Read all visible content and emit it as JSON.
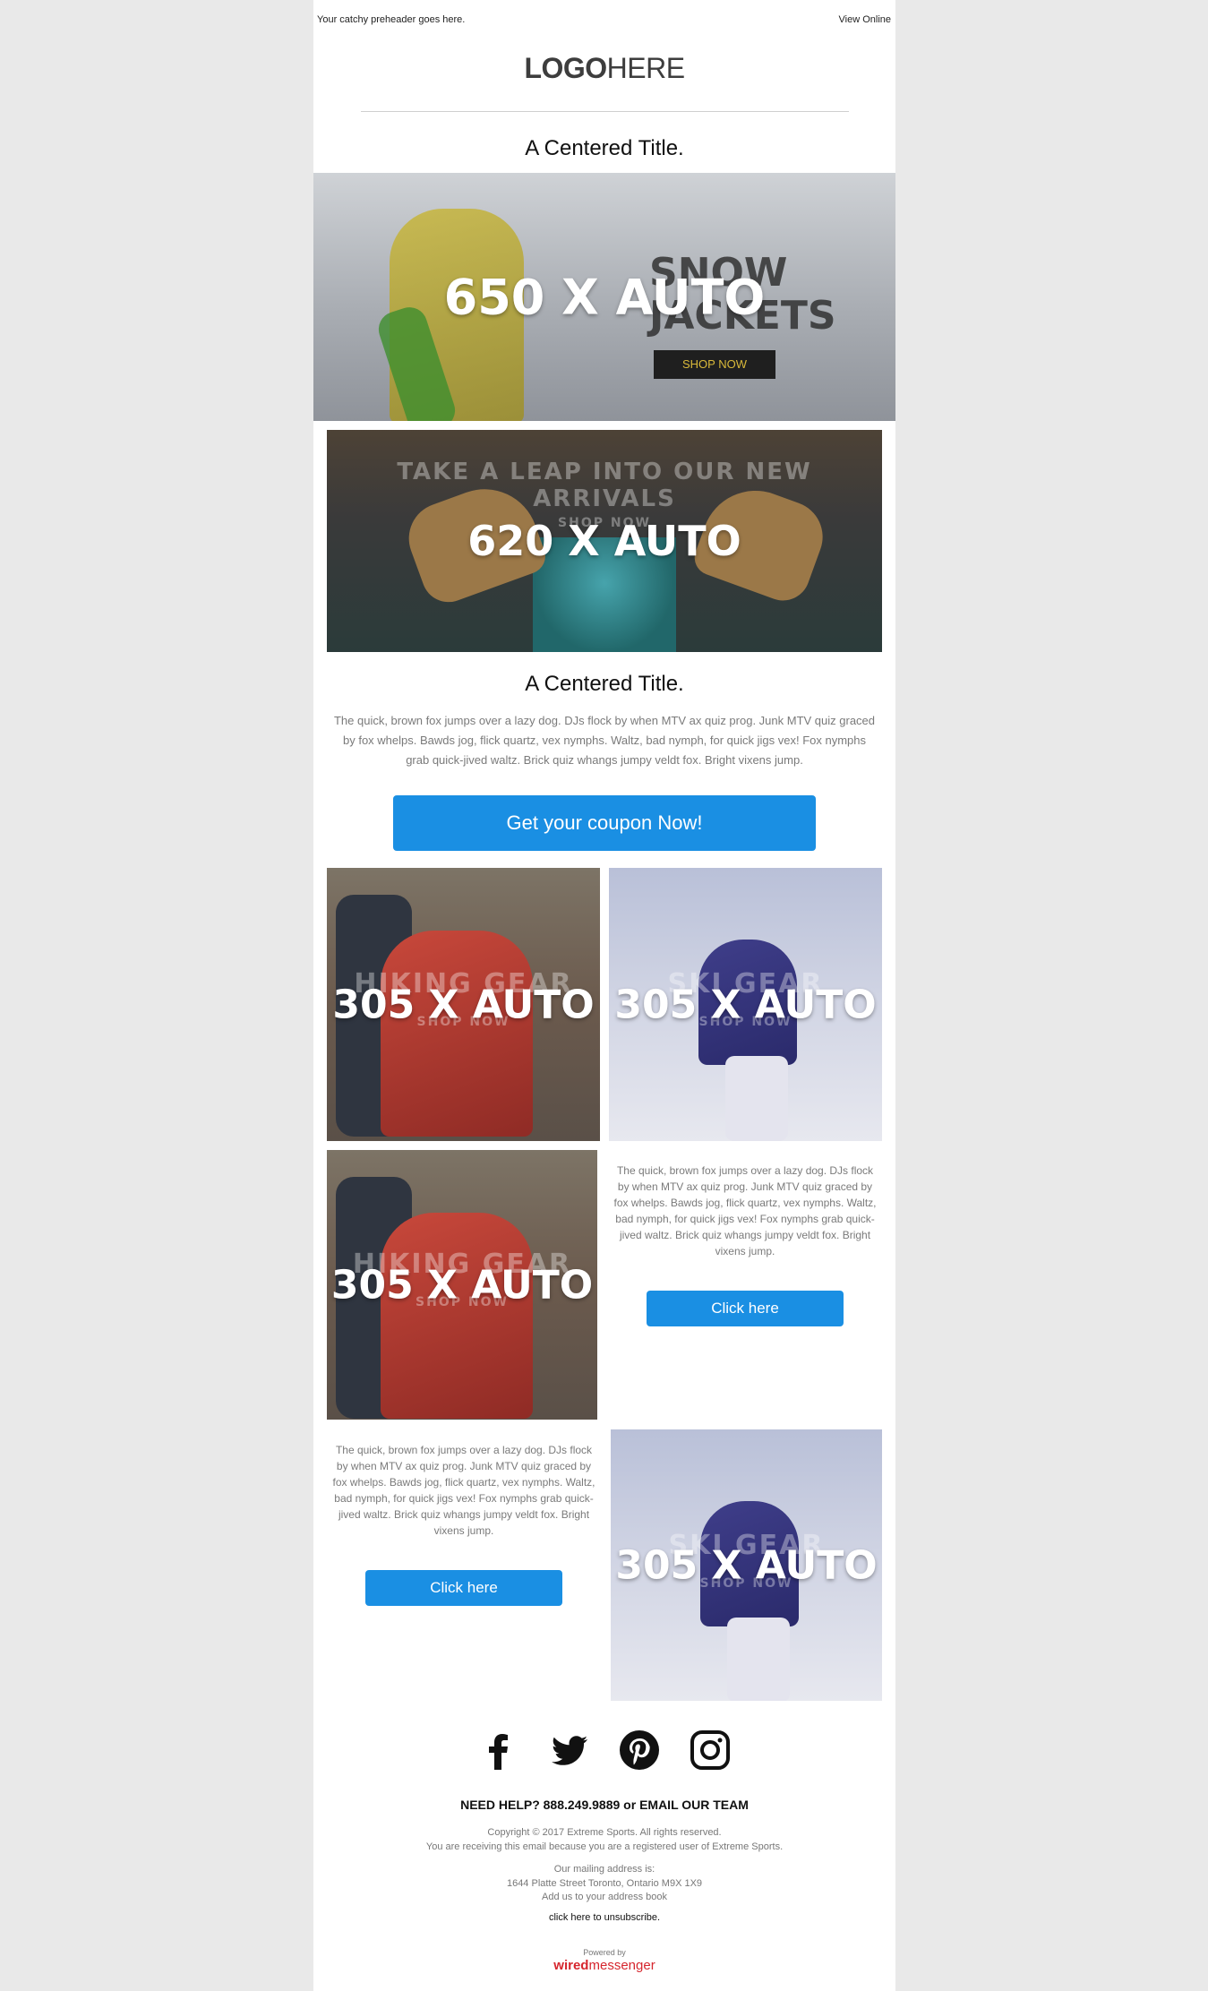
{
  "preheader": {
    "text": "Your catchy preheader goes here.",
    "view_online": "View Online"
  },
  "logo": {
    "bold": "LOGO",
    "regular": "HERE"
  },
  "titles": {
    "top": "A Centered Title.",
    "middle": "A Centered Title."
  },
  "hero": {
    "placeholder": "650 X AUTO",
    "line1": "SNOW",
    "line2": "JACKETS",
    "shop": "SHOP NOW"
  },
  "banner2": {
    "placeholder": "620 X AUTO",
    "headline": "TAKE A LEAP INTO OUR NEW ARRIVALS",
    "shop": "SHOP NOW"
  },
  "body_text": "The quick, brown fox jumps over a lazy dog. DJs flock by when MTV ax quiz prog. Junk MTV quiz graced by fox whelps. Bawds jog, flick quartz, vex nymphs. Waltz, bad nymph, for quick jigs vex! Fox nymphs grab quick-jived waltz. Brick quiz whangs jumpy veldt fox. Bright vixens jump.",
  "coupon_button": "Get your coupon Now!",
  "grid": {
    "hiking": {
      "placeholder": "305 X AUTO",
      "label": "HIKING GEAR",
      "shop": "SHOP NOW"
    },
    "ski": {
      "placeholder": "305 X AUTO",
      "label": "SKI GEAR",
      "shop": "SHOP NOW"
    },
    "hiking2": {
      "placeholder": "305 X AUTO",
      "label": "HIKING GEAR",
      "shop": "SHOP NOW"
    },
    "ski2": {
      "placeholder": "305 X AUTO",
      "label": "SKI GEAR",
      "shop": "SHOP NOW"
    },
    "text1": "The quick, brown fox jumps over a lazy dog. DJs flock by when MTV ax quiz prog. Junk MTV quiz graced by fox whelps. Bawds jog, flick quartz, vex nymphs. Waltz, bad nymph, for quick jigs vex! Fox nymphs grab quick-jived waltz. Brick quiz whangs jumpy veldt fox. Bright vixens jump.",
    "text2": "The quick, brown fox jumps over a lazy dog. DJs flock by when MTV ax quiz prog. Junk MTV quiz graced by fox whelps. Bawds jog, flick quartz, vex nymphs. Waltz, bad nymph, for quick jigs vex! Fox nymphs grab quick-jived waltz. Brick quiz whangs jumpy veldt fox. Bright vixens jump.",
    "button1": "Click here",
    "button2": "Click here"
  },
  "social": [
    "facebook-icon",
    "twitter-icon",
    "pinterest-icon",
    "instagram-icon"
  ],
  "footer": {
    "help": "NEED HELP? 888.249.9889 or EMAIL OUR TEAM",
    "copyright": "Copyright © 2017 Extreme Sports. All rights reserved.",
    "receiving": "You are receiving this email because you are a registered user of Extreme Sports.",
    "mailing_label": "Our mailing address is:",
    "address": "1644 Platte Street Toronto, Ontario M9X 1X9",
    "address_book": "Add us to your address book",
    "unsubscribe": "click here to unsubscribe.",
    "powered_by": "Powered by",
    "brand_bold": "wired",
    "brand_regular": "messenger"
  },
  "colors": {
    "accent": "#1a8fe3",
    "background": "#e9e9e9",
    "brand": "#d6262e"
  }
}
